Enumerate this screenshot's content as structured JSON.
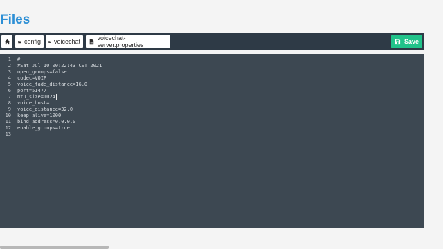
{
  "page": {
    "title": "Files"
  },
  "breadcrumb": {
    "home_icon": "home-icon",
    "items": [
      {
        "icon": "folder-icon",
        "label": "config"
      },
      {
        "icon": "folder-icon",
        "label": "voicechat"
      },
      {
        "icon": "file-icon",
        "label": "voicechat-server.properties"
      }
    ]
  },
  "toolbar": {
    "save_label": "Save",
    "save_icon": "save-icon",
    "accent": "#21c38a"
  },
  "editor": {
    "lines": [
      {
        "n": "1",
        "text": "#"
      },
      {
        "n": "2",
        "text": "#Sat Jul 10 00:22:43 CST 2021"
      },
      {
        "n": "3",
        "text": "open_groups=false"
      },
      {
        "n": "4",
        "text": "codec=VOIP"
      },
      {
        "n": "5",
        "text": "voice_fade_distance=16.0"
      },
      {
        "n": "6",
        "text": "port=51477"
      },
      {
        "n": "7",
        "text": "mtu_size=1024"
      },
      {
        "n": "8",
        "text": "voice_host="
      },
      {
        "n": "9",
        "text": "voice_distance=32.0"
      },
      {
        "n": "10",
        "text": "keep_alive=1000"
      },
      {
        "n": "11",
        "text": "bind_address=0.0.0.0"
      },
      {
        "n": "12",
        "text": "enable_groups=true"
      },
      {
        "n": "13",
        "text": ""
      }
    ],
    "cursor_line": 7
  }
}
